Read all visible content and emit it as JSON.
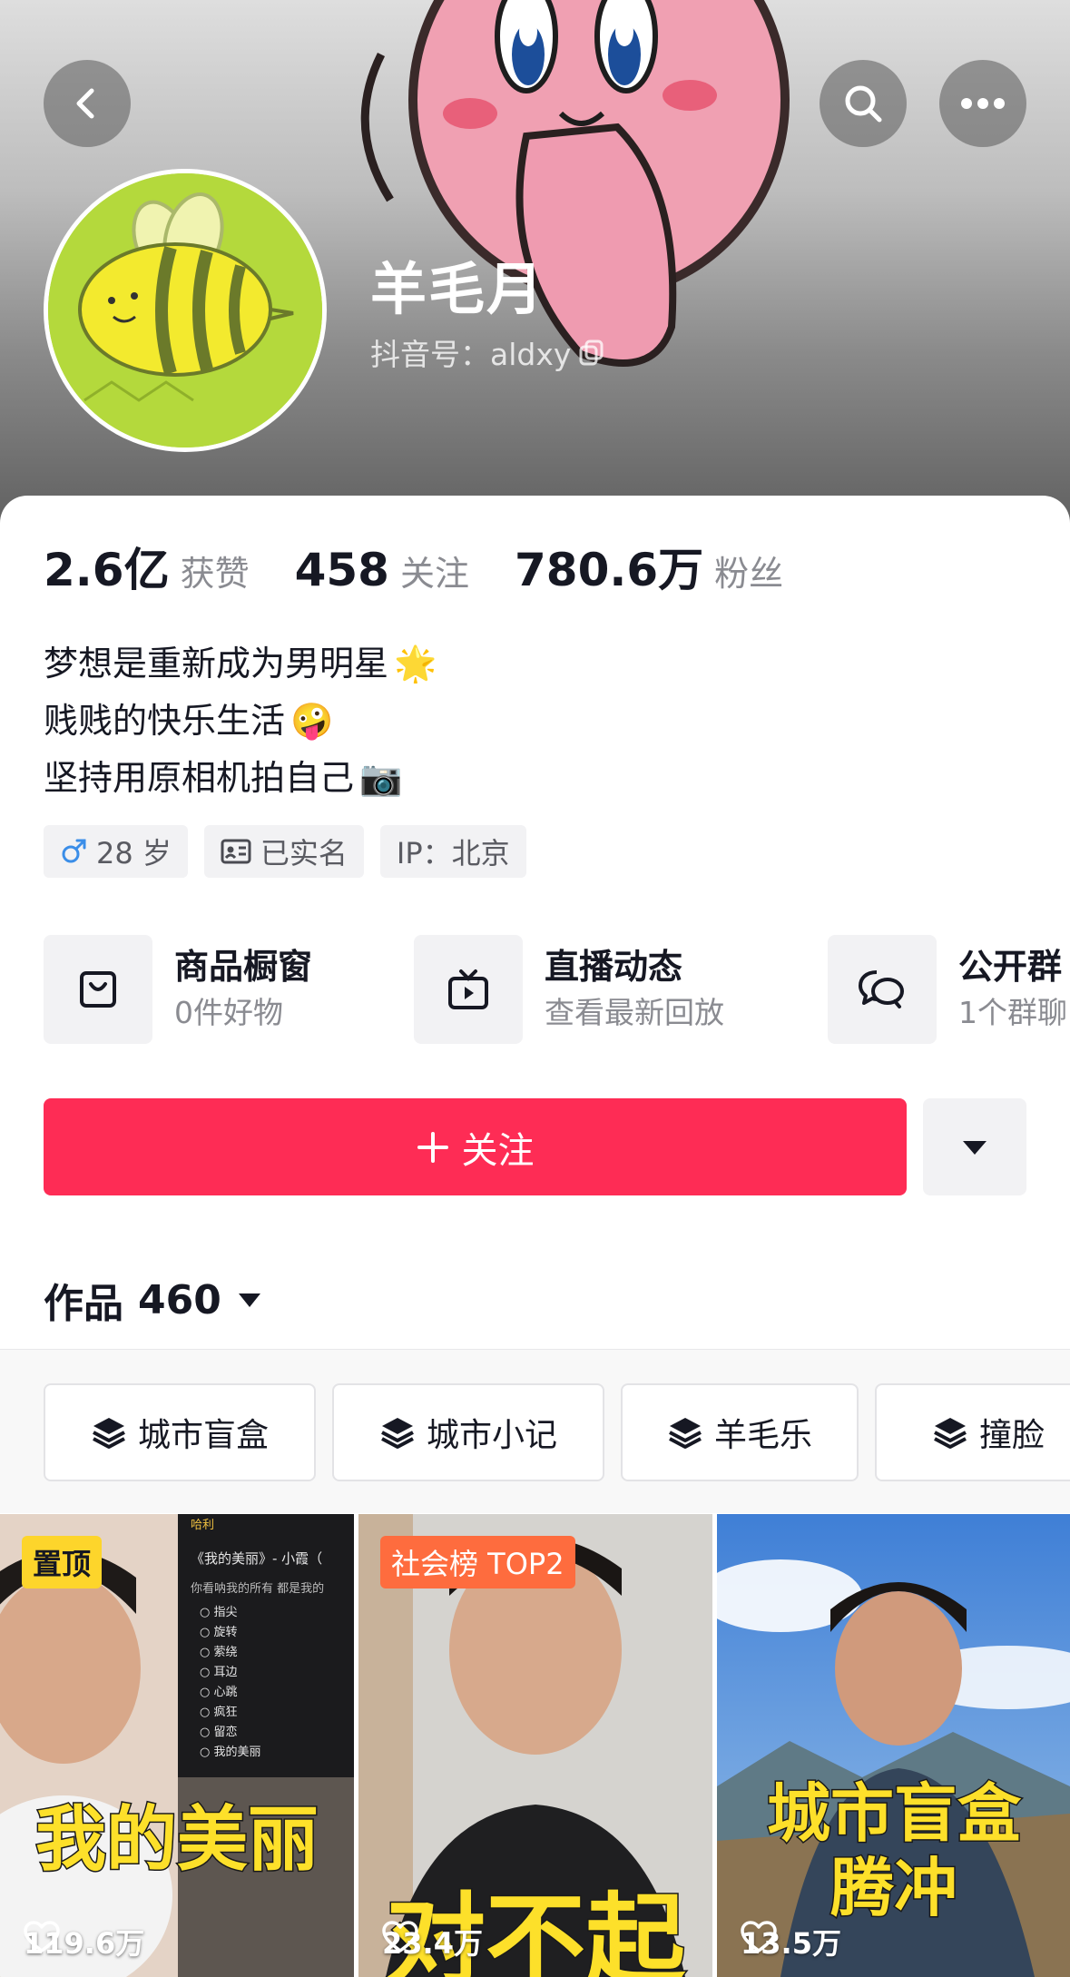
{
  "header": {
    "nickname": "羊毛月",
    "douyin_id": "抖音号：aldxy",
    "icons": {
      "back": "chevron-left-icon",
      "search": "search-icon",
      "more": "more-icon",
      "copy": "copy-icon"
    }
  },
  "stats": [
    {
      "value": "2.6亿",
      "label": "获赞"
    },
    {
      "value": "458",
      "label": "关注"
    },
    {
      "value": "780.6万",
      "label": "粉丝"
    }
  ],
  "bio": [
    {
      "text": "梦想是重新成为男明星",
      "emoji": "🌟"
    },
    {
      "text": "贱贱的快乐生活",
      "emoji": "🤪"
    },
    {
      "text": "坚持用原相机拍自己",
      "emoji": "📷"
    }
  ],
  "tags": [
    {
      "icon": "male-icon",
      "text": "28 岁"
    },
    {
      "icon": "id-card-icon",
      "text": "已实名"
    },
    {
      "icon": "",
      "text": "IP：北京"
    }
  ],
  "shortcuts": [
    {
      "icon": "shopping-bag-icon",
      "title": "商品橱窗",
      "subtitle": "0件好物"
    },
    {
      "icon": "tv-icon",
      "title": "直播动态",
      "subtitle": "查看最新回放"
    },
    {
      "icon": "chat-icon",
      "title": "公开群",
      "subtitle": "1个群聊"
    }
  ],
  "actions": {
    "follow_label": "关注",
    "follow_color": "#fe2c55"
  },
  "works": {
    "label": "作品",
    "count": "460"
  },
  "collections": [
    "城市盲盒",
    "城市小记",
    "羊毛乐",
    "撞脸"
  ],
  "videos": [
    {
      "badge": "置顶",
      "overlay_title": "我的美丽",
      "likes": "119.6万",
      "screen_header": "哈利",
      "screen_title": "《我的美丽》- 小霞（",
      "screen_subtitle": "你看呐我的所有 都是我的",
      "screen_items": [
        "指尖",
        "旋转",
        "萦绕",
        "耳边",
        "心跳",
        "疯狂",
        "留恋",
        "我的美丽"
      ]
    },
    {
      "badge": "社会榜 TOP2",
      "overlay_title": "对不起",
      "likes": "23.4万"
    },
    {
      "badge": "",
      "overlay_title": "城市盲盒",
      "overlay_title_2": "腾冲",
      "likes": "13.5万"
    }
  ]
}
